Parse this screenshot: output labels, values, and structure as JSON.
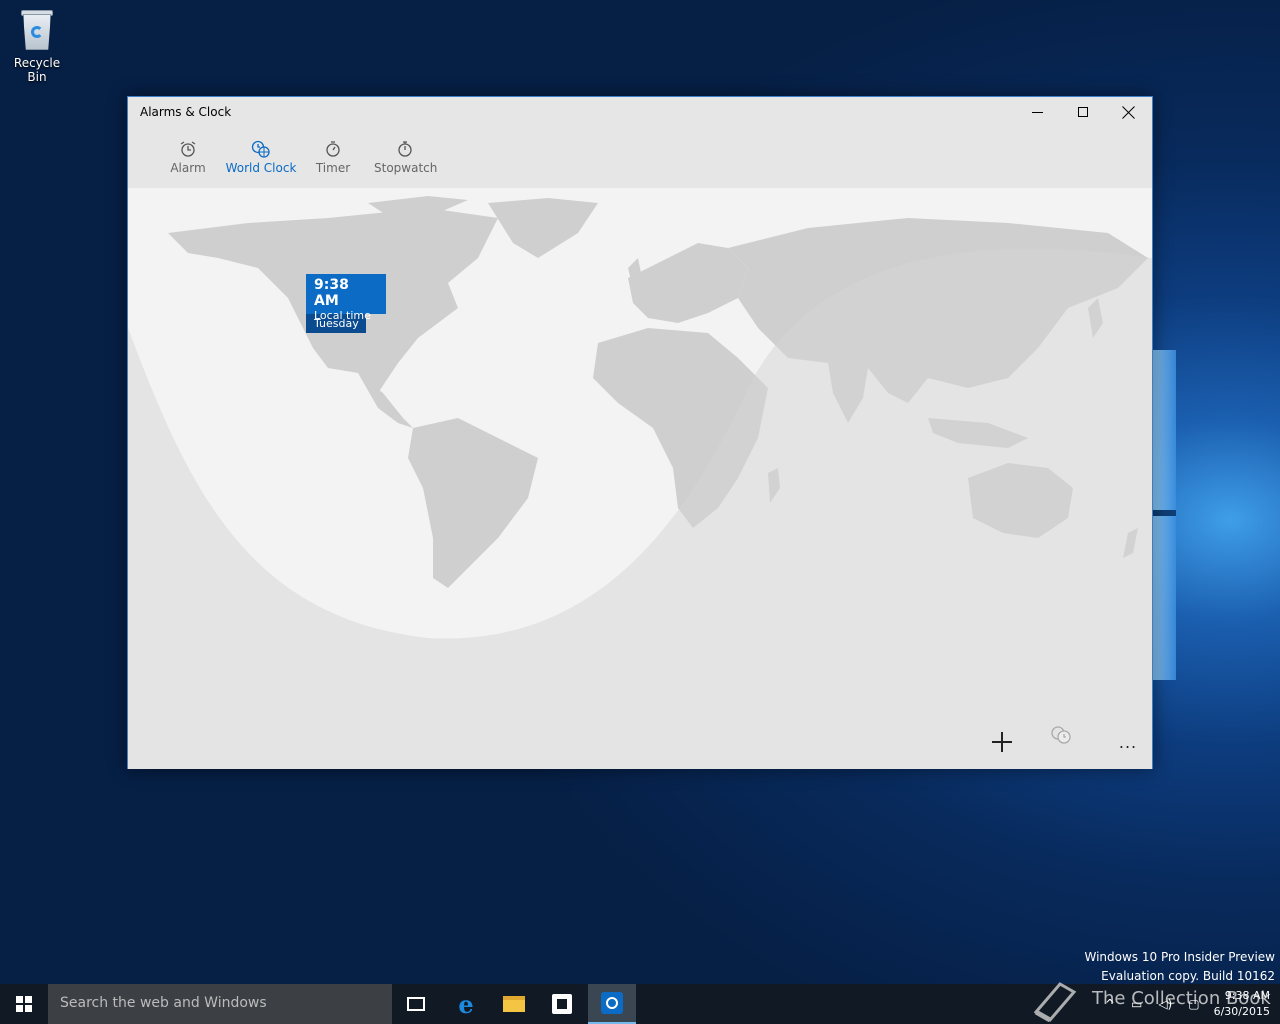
{
  "desktop": {
    "recycle_bin_label": "Recycle Bin"
  },
  "window": {
    "title": "Alarms & Clock",
    "controls": [
      "minimize",
      "maximize",
      "close"
    ]
  },
  "tabs": [
    {
      "label": "Alarm",
      "icon": "alarm-clock-icon"
    },
    {
      "label": "World Clock",
      "icon": "world-clock-icon",
      "active": true
    },
    {
      "label": "Timer",
      "icon": "timer-icon"
    },
    {
      "label": "Stopwatch",
      "icon": "stopwatch-icon"
    }
  ],
  "world_clock": {
    "local": {
      "time": "9:38 AM",
      "label": "Local time",
      "day": "Tuesday"
    }
  },
  "commands": {
    "add": "add-icon",
    "compare": "compare-clocks-icon",
    "more": "..."
  },
  "watermark": {
    "line1": "Windows 10 Pro Insider Preview",
    "line2": "Evaluation copy. Build 10162"
  },
  "taskbar": {
    "search_placeholder": "Search the web and Windows",
    "clock_time": "9:38 AM",
    "clock_date": "6/30/2015",
    "overlay_text": "The Collection Book"
  },
  "colors": {
    "accent": "#0b6bc5",
    "taskbar": "#111a24"
  }
}
